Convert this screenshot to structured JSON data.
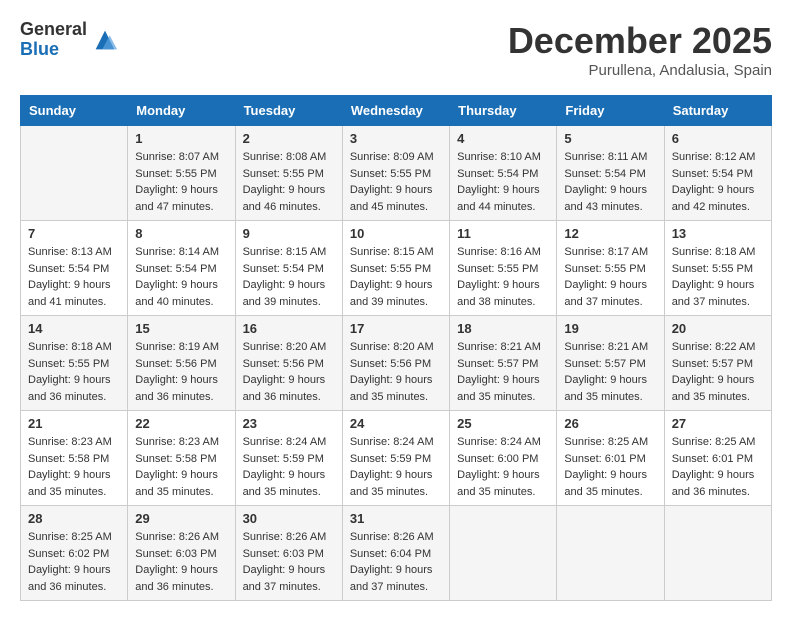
{
  "logo": {
    "general": "General",
    "blue": "Blue"
  },
  "title": "December 2025",
  "location": "Purullena, Andalusia, Spain",
  "weekdays": [
    "Sunday",
    "Monday",
    "Tuesday",
    "Wednesday",
    "Thursday",
    "Friday",
    "Saturday"
  ],
  "weeks": [
    [
      {
        "day": "",
        "sunrise": "",
        "sunset": "",
        "daylight": ""
      },
      {
        "day": "1",
        "sunrise": "Sunrise: 8:07 AM",
        "sunset": "Sunset: 5:55 PM",
        "daylight": "Daylight: 9 hours and 47 minutes."
      },
      {
        "day": "2",
        "sunrise": "Sunrise: 8:08 AM",
        "sunset": "Sunset: 5:55 PM",
        "daylight": "Daylight: 9 hours and 46 minutes."
      },
      {
        "day": "3",
        "sunrise": "Sunrise: 8:09 AM",
        "sunset": "Sunset: 5:55 PM",
        "daylight": "Daylight: 9 hours and 45 minutes."
      },
      {
        "day": "4",
        "sunrise": "Sunrise: 8:10 AM",
        "sunset": "Sunset: 5:54 PM",
        "daylight": "Daylight: 9 hours and 44 minutes."
      },
      {
        "day": "5",
        "sunrise": "Sunrise: 8:11 AM",
        "sunset": "Sunset: 5:54 PM",
        "daylight": "Daylight: 9 hours and 43 minutes."
      },
      {
        "day": "6",
        "sunrise": "Sunrise: 8:12 AM",
        "sunset": "Sunset: 5:54 PM",
        "daylight": "Daylight: 9 hours and 42 minutes."
      }
    ],
    [
      {
        "day": "7",
        "sunrise": "Sunrise: 8:13 AM",
        "sunset": "Sunset: 5:54 PM",
        "daylight": "Daylight: 9 hours and 41 minutes."
      },
      {
        "day": "8",
        "sunrise": "Sunrise: 8:14 AM",
        "sunset": "Sunset: 5:54 PM",
        "daylight": "Daylight: 9 hours and 40 minutes."
      },
      {
        "day": "9",
        "sunrise": "Sunrise: 8:15 AM",
        "sunset": "Sunset: 5:54 PM",
        "daylight": "Daylight: 9 hours and 39 minutes."
      },
      {
        "day": "10",
        "sunrise": "Sunrise: 8:15 AM",
        "sunset": "Sunset: 5:55 PM",
        "daylight": "Daylight: 9 hours and 39 minutes."
      },
      {
        "day": "11",
        "sunrise": "Sunrise: 8:16 AM",
        "sunset": "Sunset: 5:55 PM",
        "daylight": "Daylight: 9 hours and 38 minutes."
      },
      {
        "day": "12",
        "sunrise": "Sunrise: 8:17 AM",
        "sunset": "Sunset: 5:55 PM",
        "daylight": "Daylight: 9 hours and 37 minutes."
      },
      {
        "day": "13",
        "sunrise": "Sunrise: 8:18 AM",
        "sunset": "Sunset: 5:55 PM",
        "daylight": "Daylight: 9 hours and 37 minutes."
      }
    ],
    [
      {
        "day": "14",
        "sunrise": "Sunrise: 8:18 AM",
        "sunset": "Sunset: 5:55 PM",
        "daylight": "Daylight: 9 hours and 36 minutes."
      },
      {
        "day": "15",
        "sunrise": "Sunrise: 8:19 AM",
        "sunset": "Sunset: 5:56 PM",
        "daylight": "Daylight: 9 hours and 36 minutes."
      },
      {
        "day": "16",
        "sunrise": "Sunrise: 8:20 AM",
        "sunset": "Sunset: 5:56 PM",
        "daylight": "Daylight: 9 hours and 36 minutes."
      },
      {
        "day": "17",
        "sunrise": "Sunrise: 8:20 AM",
        "sunset": "Sunset: 5:56 PM",
        "daylight": "Daylight: 9 hours and 35 minutes."
      },
      {
        "day": "18",
        "sunrise": "Sunrise: 8:21 AM",
        "sunset": "Sunset: 5:57 PM",
        "daylight": "Daylight: 9 hours and 35 minutes."
      },
      {
        "day": "19",
        "sunrise": "Sunrise: 8:21 AM",
        "sunset": "Sunset: 5:57 PM",
        "daylight": "Daylight: 9 hours and 35 minutes."
      },
      {
        "day": "20",
        "sunrise": "Sunrise: 8:22 AM",
        "sunset": "Sunset: 5:57 PM",
        "daylight": "Daylight: 9 hours and 35 minutes."
      }
    ],
    [
      {
        "day": "21",
        "sunrise": "Sunrise: 8:23 AM",
        "sunset": "Sunset: 5:58 PM",
        "daylight": "Daylight: 9 hours and 35 minutes."
      },
      {
        "day": "22",
        "sunrise": "Sunrise: 8:23 AM",
        "sunset": "Sunset: 5:58 PM",
        "daylight": "Daylight: 9 hours and 35 minutes."
      },
      {
        "day": "23",
        "sunrise": "Sunrise: 8:24 AM",
        "sunset": "Sunset: 5:59 PM",
        "daylight": "Daylight: 9 hours and 35 minutes."
      },
      {
        "day": "24",
        "sunrise": "Sunrise: 8:24 AM",
        "sunset": "Sunset: 5:59 PM",
        "daylight": "Daylight: 9 hours and 35 minutes."
      },
      {
        "day": "25",
        "sunrise": "Sunrise: 8:24 AM",
        "sunset": "Sunset: 6:00 PM",
        "daylight": "Daylight: 9 hours and 35 minutes."
      },
      {
        "day": "26",
        "sunrise": "Sunrise: 8:25 AM",
        "sunset": "Sunset: 6:01 PM",
        "daylight": "Daylight: 9 hours and 35 minutes."
      },
      {
        "day": "27",
        "sunrise": "Sunrise: 8:25 AM",
        "sunset": "Sunset: 6:01 PM",
        "daylight": "Daylight: 9 hours and 36 minutes."
      }
    ],
    [
      {
        "day": "28",
        "sunrise": "Sunrise: 8:25 AM",
        "sunset": "Sunset: 6:02 PM",
        "daylight": "Daylight: 9 hours and 36 minutes."
      },
      {
        "day": "29",
        "sunrise": "Sunrise: 8:26 AM",
        "sunset": "Sunset: 6:03 PM",
        "daylight": "Daylight: 9 hours and 36 minutes."
      },
      {
        "day": "30",
        "sunrise": "Sunrise: 8:26 AM",
        "sunset": "Sunset: 6:03 PM",
        "daylight": "Daylight: 9 hours and 37 minutes."
      },
      {
        "day": "31",
        "sunrise": "Sunrise: 8:26 AM",
        "sunset": "Sunset: 6:04 PM",
        "daylight": "Daylight: 9 hours and 37 minutes."
      },
      {
        "day": "",
        "sunrise": "",
        "sunset": "",
        "daylight": ""
      },
      {
        "day": "",
        "sunrise": "",
        "sunset": "",
        "daylight": ""
      },
      {
        "day": "",
        "sunrise": "",
        "sunset": "",
        "daylight": ""
      }
    ]
  ]
}
